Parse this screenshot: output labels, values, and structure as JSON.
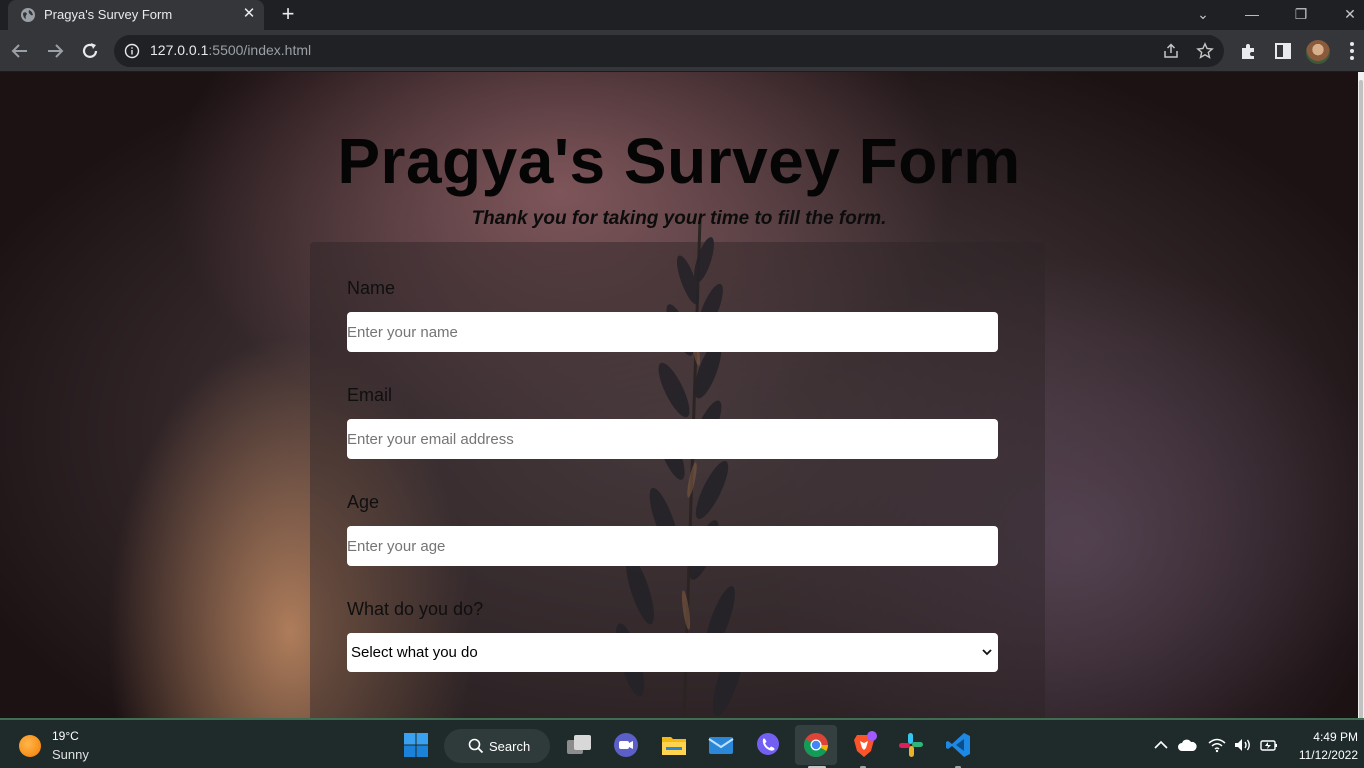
{
  "browser": {
    "tab_title": "Pragya's Survey Form",
    "url_host": "127.0.0.1",
    "url_rest": ":5500/index.html"
  },
  "page": {
    "title": "Pragya's Survey Form",
    "subtitle": "Thank you for taking your time to fill the form.",
    "fields": [
      {
        "label": "Name",
        "placeholder": "Enter your name"
      },
      {
        "label": "Email",
        "placeholder": "Enter your email address"
      },
      {
        "label": "Age",
        "placeholder": "Enter your age"
      }
    ],
    "occupation": {
      "label": "What do you do?",
      "selected": "Select what you do"
    }
  },
  "taskbar": {
    "weather_temp": "19°C",
    "weather_condition": "Sunny",
    "search_label": "Search",
    "time": "4:49 PM",
    "date": "11/12/2022",
    "apps": [
      "start-icon",
      "search-icon",
      "task-view-icon",
      "teams-chat-icon",
      "file-explorer-icon",
      "mail-icon",
      "viber-icon",
      "chrome-icon",
      "brave-icon",
      "slack-icon",
      "vscode-icon"
    ]
  },
  "colors": {
    "browser_frame": "#35363a",
    "omnibox": "#202124",
    "title_text": "#050505",
    "taskbar": "#1e2b2a"
  }
}
